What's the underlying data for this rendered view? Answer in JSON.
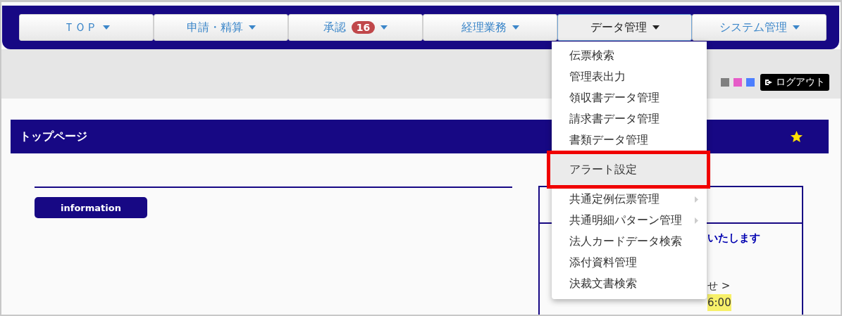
{
  "nav_tabs": [
    {
      "label": "ＴＯＰ",
      "selected": false
    },
    {
      "label": "申請・精算",
      "selected": false
    },
    {
      "label": "承認",
      "badge": "16",
      "selected": false
    },
    {
      "label": "経理業務",
      "selected": false
    },
    {
      "label": "データ管理",
      "selected": true
    },
    {
      "label": "システム管理",
      "selected": false
    }
  ],
  "theme_swatches": [
    {
      "color": "#808080"
    },
    {
      "color": "#e65cc8"
    },
    {
      "color": "#4d7fff"
    }
  ],
  "logout_button": "ログアウト",
  "page_title": "トップページ",
  "favorite": true,
  "information_button": "information",
  "panel_fragments": [
    {
      "text": "いたします",
      "kind": "notice"
    },
    {
      "text": "せ >",
      "kind": "plain"
    },
    {
      "text": "6:00",
      "kind": "highlight"
    }
  ],
  "dropdown": {
    "items": [
      {
        "label": "伝票検索",
        "selected": false,
        "submenu": false,
        "annotated": false
      },
      {
        "label": "管理表出力",
        "selected": false,
        "submenu": false,
        "annotated": false
      },
      {
        "label": "領収書データ管理",
        "selected": false,
        "submenu": false,
        "annotated": false
      },
      {
        "label": "請求書データ管理",
        "selected": false,
        "submenu": false,
        "annotated": false
      },
      {
        "label": "書類データ管理",
        "selected": false,
        "submenu": false,
        "annotated": false
      },
      {
        "label": "アラート設定",
        "selected": true,
        "submenu": false,
        "annotated": true
      },
      {
        "label": "共通定例伝票管理",
        "selected": false,
        "submenu": true,
        "annotated": false
      },
      {
        "label": "共通明細パターン管理",
        "selected": false,
        "submenu": true,
        "annotated": false
      },
      {
        "label": "法人カードデータ検索",
        "selected": false,
        "submenu": false,
        "annotated": false
      },
      {
        "label": "添付資料管理",
        "selected": false,
        "submenu": false,
        "annotated": false
      },
      {
        "label": "決裁文書検索",
        "selected": false,
        "submenu": false,
        "annotated": false
      }
    ]
  }
}
